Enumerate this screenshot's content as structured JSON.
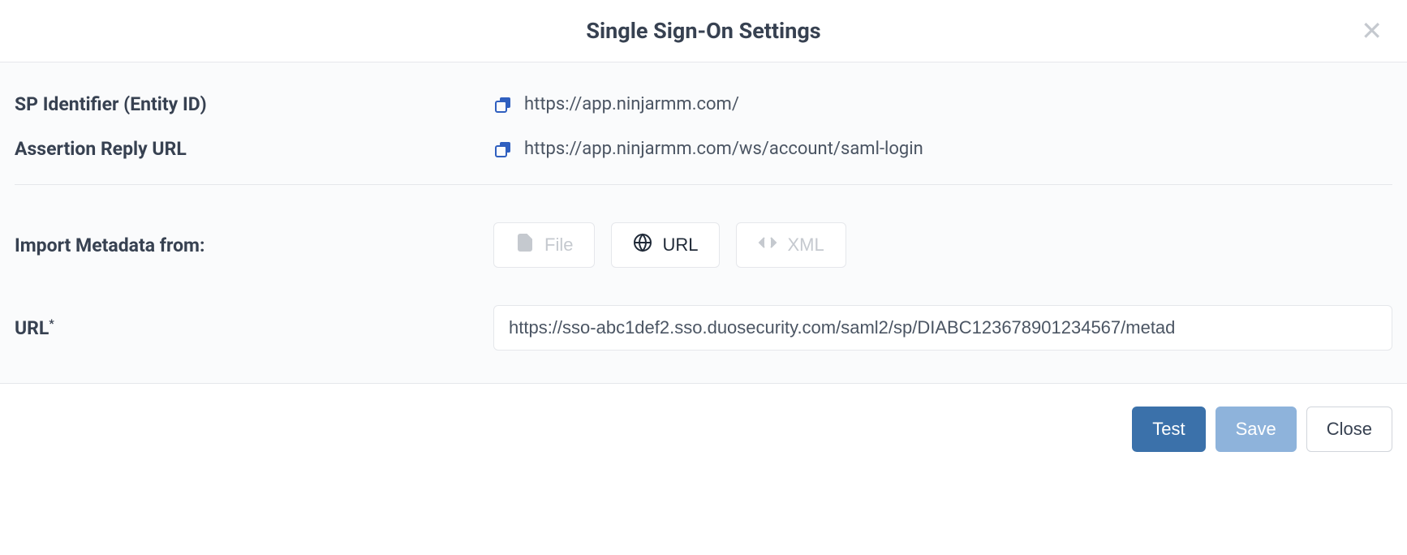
{
  "modal": {
    "title": "Single Sign-On Settings"
  },
  "fields": {
    "sp_identifier": {
      "label": "SP Identifier (Entity ID)",
      "value": "https://app.ninjarmm.com/"
    },
    "assertion_reply": {
      "label": "Assertion Reply URL",
      "value": "https://app.ninjarmm.com/ws/account/saml-login"
    },
    "import_metadata": {
      "label": "Import Metadata from:",
      "options": {
        "file": "File",
        "url": "URL",
        "xml": "XML"
      },
      "selected": "url"
    },
    "url": {
      "label": "URL",
      "required_marker": "*",
      "value": "https://sso-abc1def2.sso.duosecurity.com/saml2/sp/DIABC123678901234567/metad"
    }
  },
  "footer": {
    "test": "Test",
    "save": "Save",
    "close": "Close"
  }
}
